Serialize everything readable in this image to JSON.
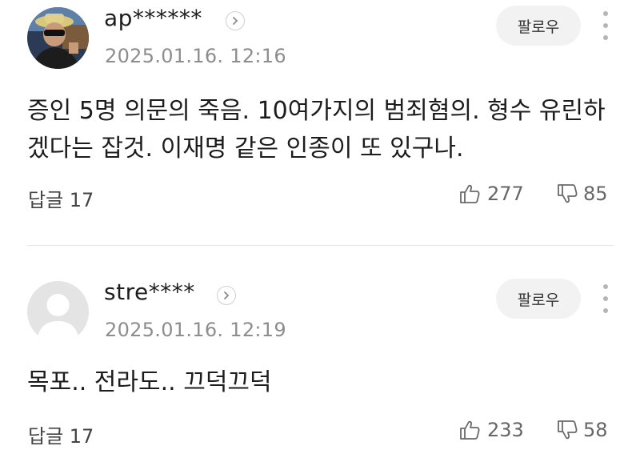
{
  "comments": [
    {
      "username": "ap******",
      "date": "2025.01.16. 12:16",
      "follow_label": "팔로우",
      "body": "증인 5명 의문의 죽음. 10여가지의 범죄혐의. 형수 유린하겠다는 잡것. 이재명 같은 인종이 또 있구나.",
      "reply_label": "답글 17",
      "likes": "277",
      "dislikes": "85",
      "avatar": "profile-photo"
    },
    {
      "username": "stre****",
      "date": "2025.01.16. 12:19",
      "follow_label": "팔로우",
      "body": "목포.. 전라도.. 끄덕끄덕",
      "reply_label": "답글 17",
      "likes": "233",
      "dislikes": "58",
      "avatar": "default-avatar"
    }
  ],
  "icons": {
    "profile": "chevron-right-icon",
    "more": "more-vertical-icon",
    "like": "thumbs-up-icon",
    "dislike": "thumbs-down-icon"
  },
  "colors": {
    "follow_bg": "#f2f2f2",
    "date": "#8d8d8d",
    "divider": "#e6e6e6"
  }
}
